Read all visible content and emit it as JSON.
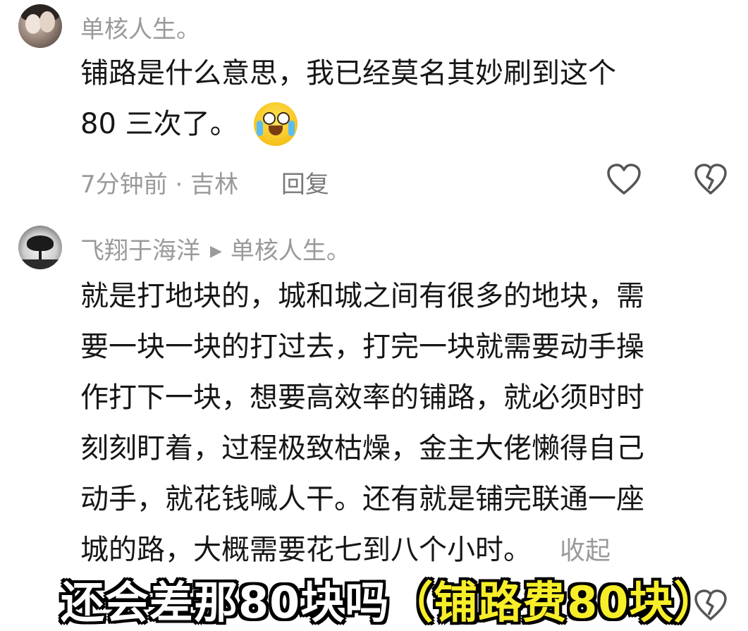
{
  "comment1": {
    "username": "单核人生。",
    "text_lines": [
      "铺路是什么意思，我已经莫名其妙刷到这个",
      "80 三次了。"
    ],
    "emoji": "crying-laughing-emoji",
    "time": "7分钟前",
    "separator": "·",
    "location": "吉林",
    "reply_label": "回复",
    "like_icon": "heart-outline-icon",
    "dislike_icon": "broken-heart-icon"
  },
  "comment2": {
    "username": "飞翔于海洋",
    "reply_to": "单核人生。",
    "text_lines": [
      "就是打地块的，城和城之间有很多的地块，需",
      "要一块一块的打过去，打完一块就需要动手操",
      "作打下一块，想要高效率的铺路，就必须时时",
      "刻刻盯着，过程极致枯燥，金主大佬懒得自己",
      "动手，就花钱喊人干。还有就是铺完联通一座",
      "城的路，大概需要花七到八个小时。"
    ],
    "collapse_label": "收起",
    "dislike_icon": "broken-heart-icon"
  },
  "caption": {
    "white_part": "还会差那80块吗",
    "yellow_part": "（铺路费80块）"
  }
}
